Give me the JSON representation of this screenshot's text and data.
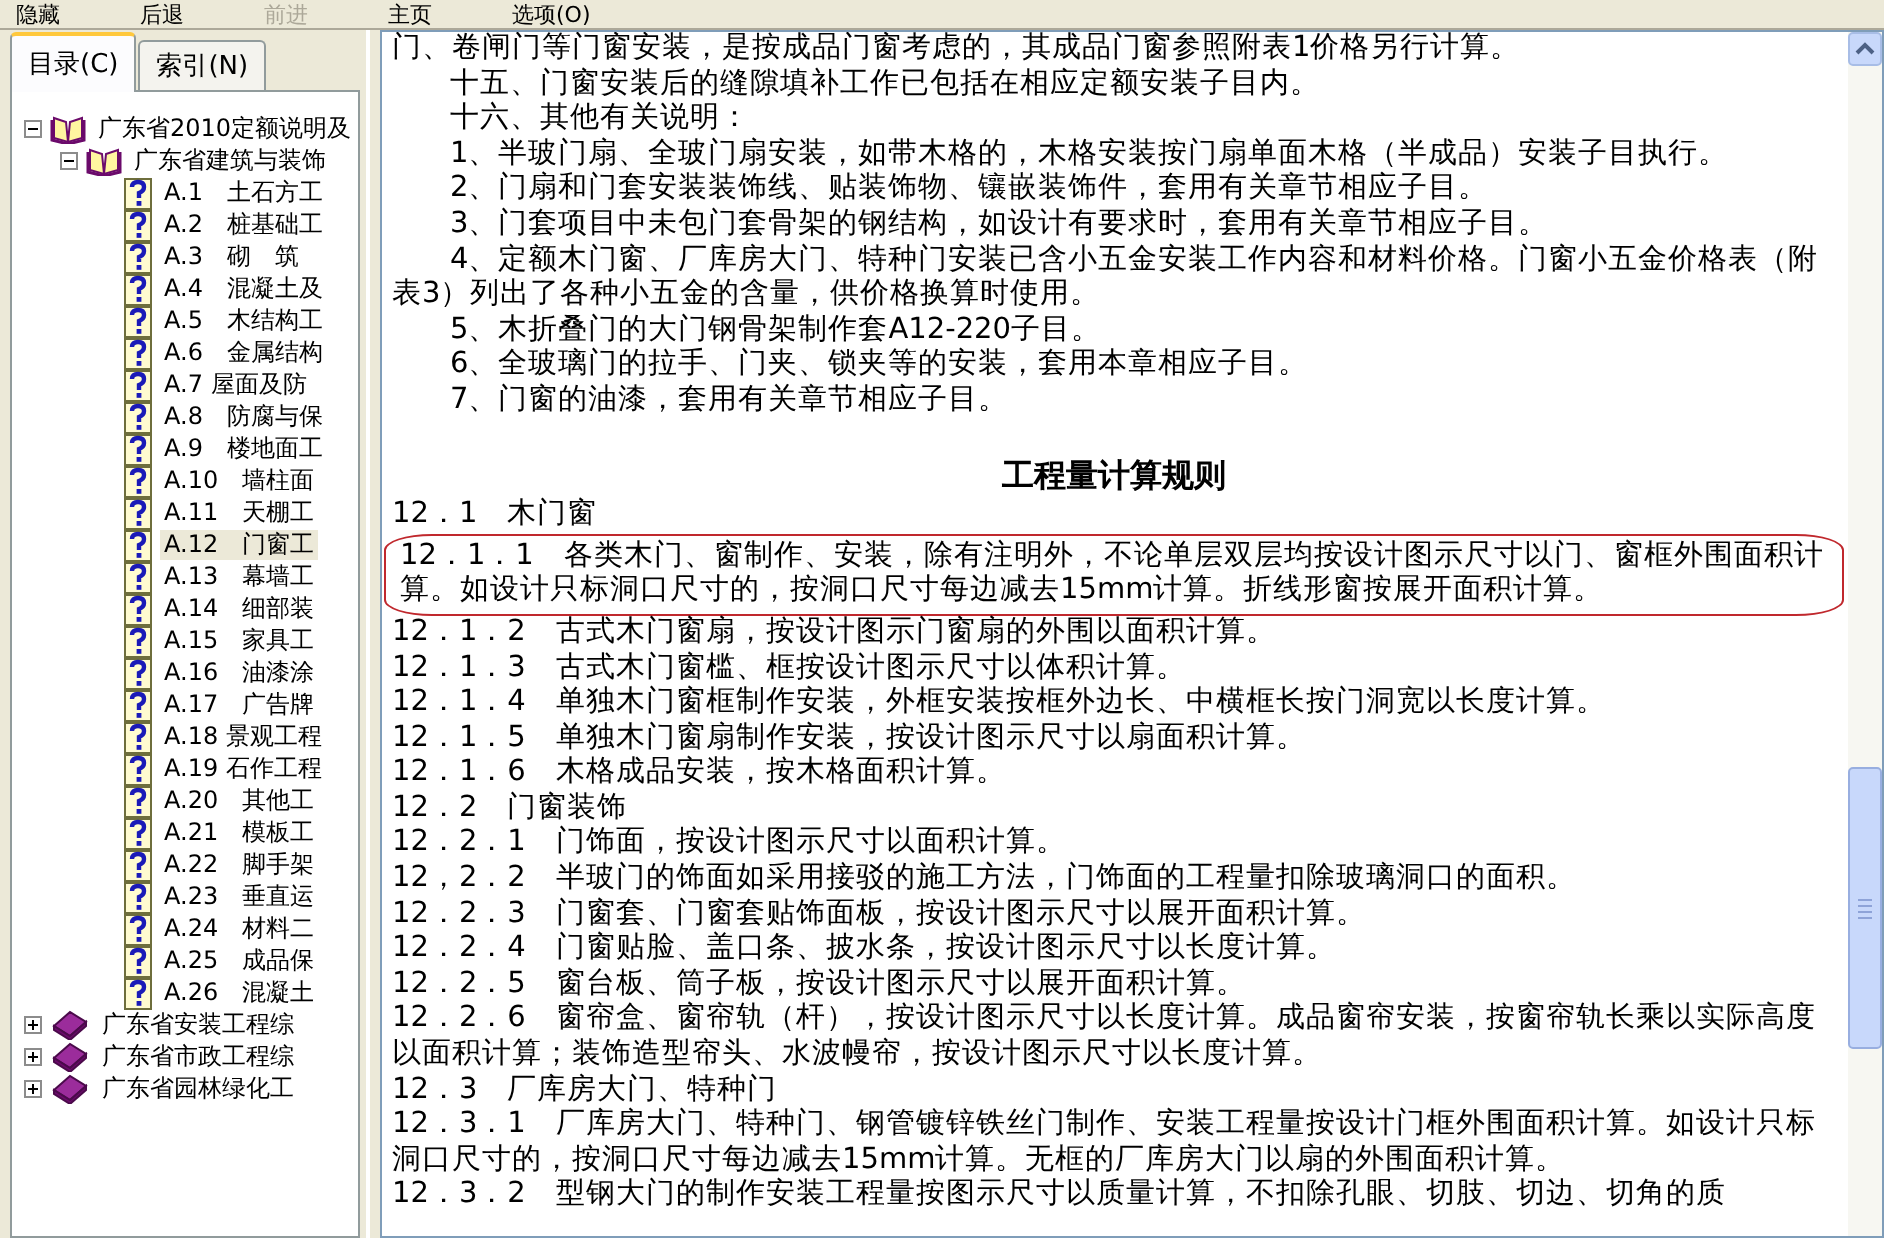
{
  "toolbar": {
    "buttons": [
      {
        "label": "隐藏",
        "disabled": false
      },
      {
        "label": "后退",
        "disabled": false
      },
      {
        "label": "前进",
        "disabled": true
      },
      {
        "label": "主页",
        "disabled": false
      },
      {
        "label": "选项(O)",
        "disabled": false
      }
    ]
  },
  "sidebar": {
    "tabs": [
      {
        "label": "目录(C)",
        "selected": true
      },
      {
        "label": "索引(N)",
        "selected": false
      }
    ],
    "tree": [
      {
        "kind": "book",
        "label": "广东省2010定额说明及",
        "expanded": true,
        "selected": false,
        "children": [
          {
            "kind": "book",
            "label": "广东省建筑与装饰",
            "expanded": true,
            "selected": false,
            "children": [
              {
                "kind": "page",
                "label": "A.1　土石方工",
                "selected": false
              },
              {
                "kind": "page",
                "label": "A.2　桩基础工",
                "selected": false
              },
              {
                "kind": "page",
                "label": "A.3　砌　筑",
                "selected": false
              },
              {
                "kind": "page",
                "label": "A.4　混凝土及",
                "selected": false
              },
              {
                "kind": "page",
                "label": "A.5　木结构工",
                "selected": false
              },
              {
                "kind": "page",
                "label": "A.6　金属结构",
                "selected": false
              },
              {
                "kind": "page",
                "label": "A.7 屋面及防",
                "selected": false
              },
              {
                "kind": "page",
                "label": "A.8　防腐与保",
                "selected": false
              },
              {
                "kind": "page",
                "label": "A.9　楼地面工",
                "selected": false
              },
              {
                "kind": "page",
                "label": "A.10　墙柱面",
                "selected": false
              },
              {
                "kind": "page",
                "label": "A.11　天棚工",
                "selected": false
              },
              {
                "kind": "page",
                "label": "A.12　门窗工",
                "selected": true
              },
              {
                "kind": "page",
                "label": "A.13　幕墙工",
                "selected": false
              },
              {
                "kind": "page",
                "label": "A.14　细部装",
                "selected": false
              },
              {
                "kind": "page",
                "label": "A.15　家具工",
                "selected": false
              },
              {
                "kind": "page",
                "label": "A.16　油漆涂",
                "selected": false
              },
              {
                "kind": "page",
                "label": "A.17　广告牌",
                "selected": false
              },
              {
                "kind": "page",
                "label": "A.18 景观工程",
                "selected": false
              },
              {
                "kind": "page",
                "label": "A.19 石作工程",
                "selected": false
              },
              {
                "kind": "page",
                "label": "A.20　其他工",
                "selected": false
              },
              {
                "kind": "page",
                "label": "A.21　模板工",
                "selected": false
              },
              {
                "kind": "page",
                "label": "A.22　脚手架",
                "selected": false
              },
              {
                "kind": "page",
                "label": "A.23　垂直运",
                "selected": false
              },
              {
                "kind": "page",
                "label": "A.24　材料二",
                "selected": false
              },
              {
                "kind": "page",
                "label": "A.25　成品保",
                "selected": false
              },
              {
                "kind": "page",
                "label": "A.26　混凝土",
                "selected": false
              }
            ]
          }
        ]
      },
      {
        "kind": "book",
        "label": "广东省安装工程综",
        "expanded": false,
        "selected": false
      },
      {
        "kind": "book",
        "label": "广东省市政工程综",
        "expanded": false,
        "selected": false
      },
      {
        "kind": "book",
        "label": "广东省园林绿化工",
        "expanded": false,
        "selected": false
      }
    ]
  },
  "document": {
    "paragraphs": [
      {
        "kind": "plain",
        "text": "门、卷闸门等门窗安装，是按成品门窗考虑的，其成品门窗参照附表1价格另行计算。",
        "circled": false
      },
      {
        "kind": "indent",
        "text": "十五、门窗安装后的缝隙填补工作已包括在相应定额安装子目内。",
        "circled": false
      },
      {
        "kind": "indent",
        "text": "十六、其他有关说明：",
        "circled": false
      },
      {
        "kind": "indent",
        "text": "1、半玻门扇、全玻门扇安装，如带木格的，木格安装按门扇单面木格（半成品）安装子目执行。",
        "circled": false
      },
      {
        "kind": "indent",
        "text": "2、门扇和门套安装装饰线、贴装饰物、镶嵌装饰件，套用有关章节相应子目。",
        "circled": false
      },
      {
        "kind": "indent",
        "text": "3、门套项目中未包门套骨架的钢结构，如设计有要求时，套用有关章节相应子目。",
        "circled": false
      },
      {
        "kind": "indent",
        "text": "4、定额木门窗、厂库房大门、特种门安装已含小五金安装工作内容和材料价格。门窗小五金价格表（附表3）列出了各种小五金的含量，供价格换算时使用。",
        "circled": false
      },
      {
        "kind": "indent",
        "text": "5、木折叠门的大门钢骨架制作套A12-220子目。",
        "circled": false
      },
      {
        "kind": "indent",
        "text": "6、全玻璃门的拉手、门夹、锁夹等的安装，套用本章相应子目。",
        "circled": false
      },
      {
        "kind": "indent",
        "text": "7、门窗的油漆，套用有关章节相应子目。",
        "circled": false
      },
      {
        "kind": "heading",
        "text": "工程量计算规则",
        "circled": false
      },
      {
        "kind": "plain",
        "text": "12．1　木门窗",
        "circled": false
      },
      {
        "kind": "plain",
        "text": "12．1．1　各类木门、窗制作、安装，除有注明外，不论单层双层均按设计图示尺寸以门、窗框外围面积计算。如设计只标洞口尺寸的，按洞口尺寸每边减去15mm计算。折线形窗按展开面积计算。",
        "circled": true
      },
      {
        "kind": "plain",
        "text": "12．1．2　古式木门窗扇，按设计图示门窗扇的外围以面积计算。",
        "circled": false
      },
      {
        "kind": "plain",
        "text": "12．1．3　古式木门窗槛、框按设计图示尺寸以体积计算。",
        "circled": false
      },
      {
        "kind": "plain",
        "text": "12．1．4　单独木门窗框制作安装，外框安装按框外边长、中横框长按门洞宽以长度计算。",
        "circled": false
      },
      {
        "kind": "plain",
        "text": "12．1．5　单独木门窗扇制作安装，按设计图示尺寸以扇面积计算。",
        "circled": false
      },
      {
        "kind": "plain",
        "text": "12．1．6　木格成品安装，按木格面积计算。",
        "circled": false
      },
      {
        "kind": "plain",
        "text": "12．2　门窗装饰",
        "circled": false
      },
      {
        "kind": "plain",
        "text": "12．2．1　门饰面，按设计图示尺寸以面积计算。",
        "circled": false
      },
      {
        "kind": "plain",
        "text": "12，2．2　半玻门的饰面如采用接驳的施工方法，门饰面的工程量扣除玻璃洞口的面积。",
        "circled": false
      },
      {
        "kind": "plain",
        "text": "12．2．3　门窗套、门窗套贴饰面板，按设计图示尺寸以展开面积计算。",
        "circled": false
      },
      {
        "kind": "plain",
        "text": "12．2．4　门窗贴脸、盖口条、披水条，按设计图示尺寸以长度计算。",
        "circled": false
      },
      {
        "kind": "plain",
        "text": "12．2．5　窗台板、筒子板，按设计图示尺寸以展开面积计算。",
        "circled": false
      },
      {
        "kind": "plain",
        "text": "12．2．6　窗帘盒、窗帘轨（杆），按设计图示尺寸以长度计算。成品窗帘安装，按窗帘轨长乘以实际高度以面积计算；装饰造型帘头、水波幔帘，按设计图示尺寸以长度计算。",
        "circled": false
      },
      {
        "kind": "plain",
        "text": "12．3　厂库房大门、特种门",
        "circled": false
      },
      {
        "kind": "plain",
        "text": "12．3．1　厂库房大门、特种门、钢管镀锌铁丝门制作、安装工程量按设计门框外围面积计算。如设计只标洞口尺寸的，按洞口尺寸每边减去15mm计算。无框的厂库房大门以扇的外围面积计算。",
        "circled": false
      },
      {
        "kind": "plain",
        "text": "12．3．2　型钢大门的制作安装工程量按图示尺寸以质量计算，不扣除孔眼、切肢、切边、切角的质",
        "circled": false
      }
    ]
  }
}
